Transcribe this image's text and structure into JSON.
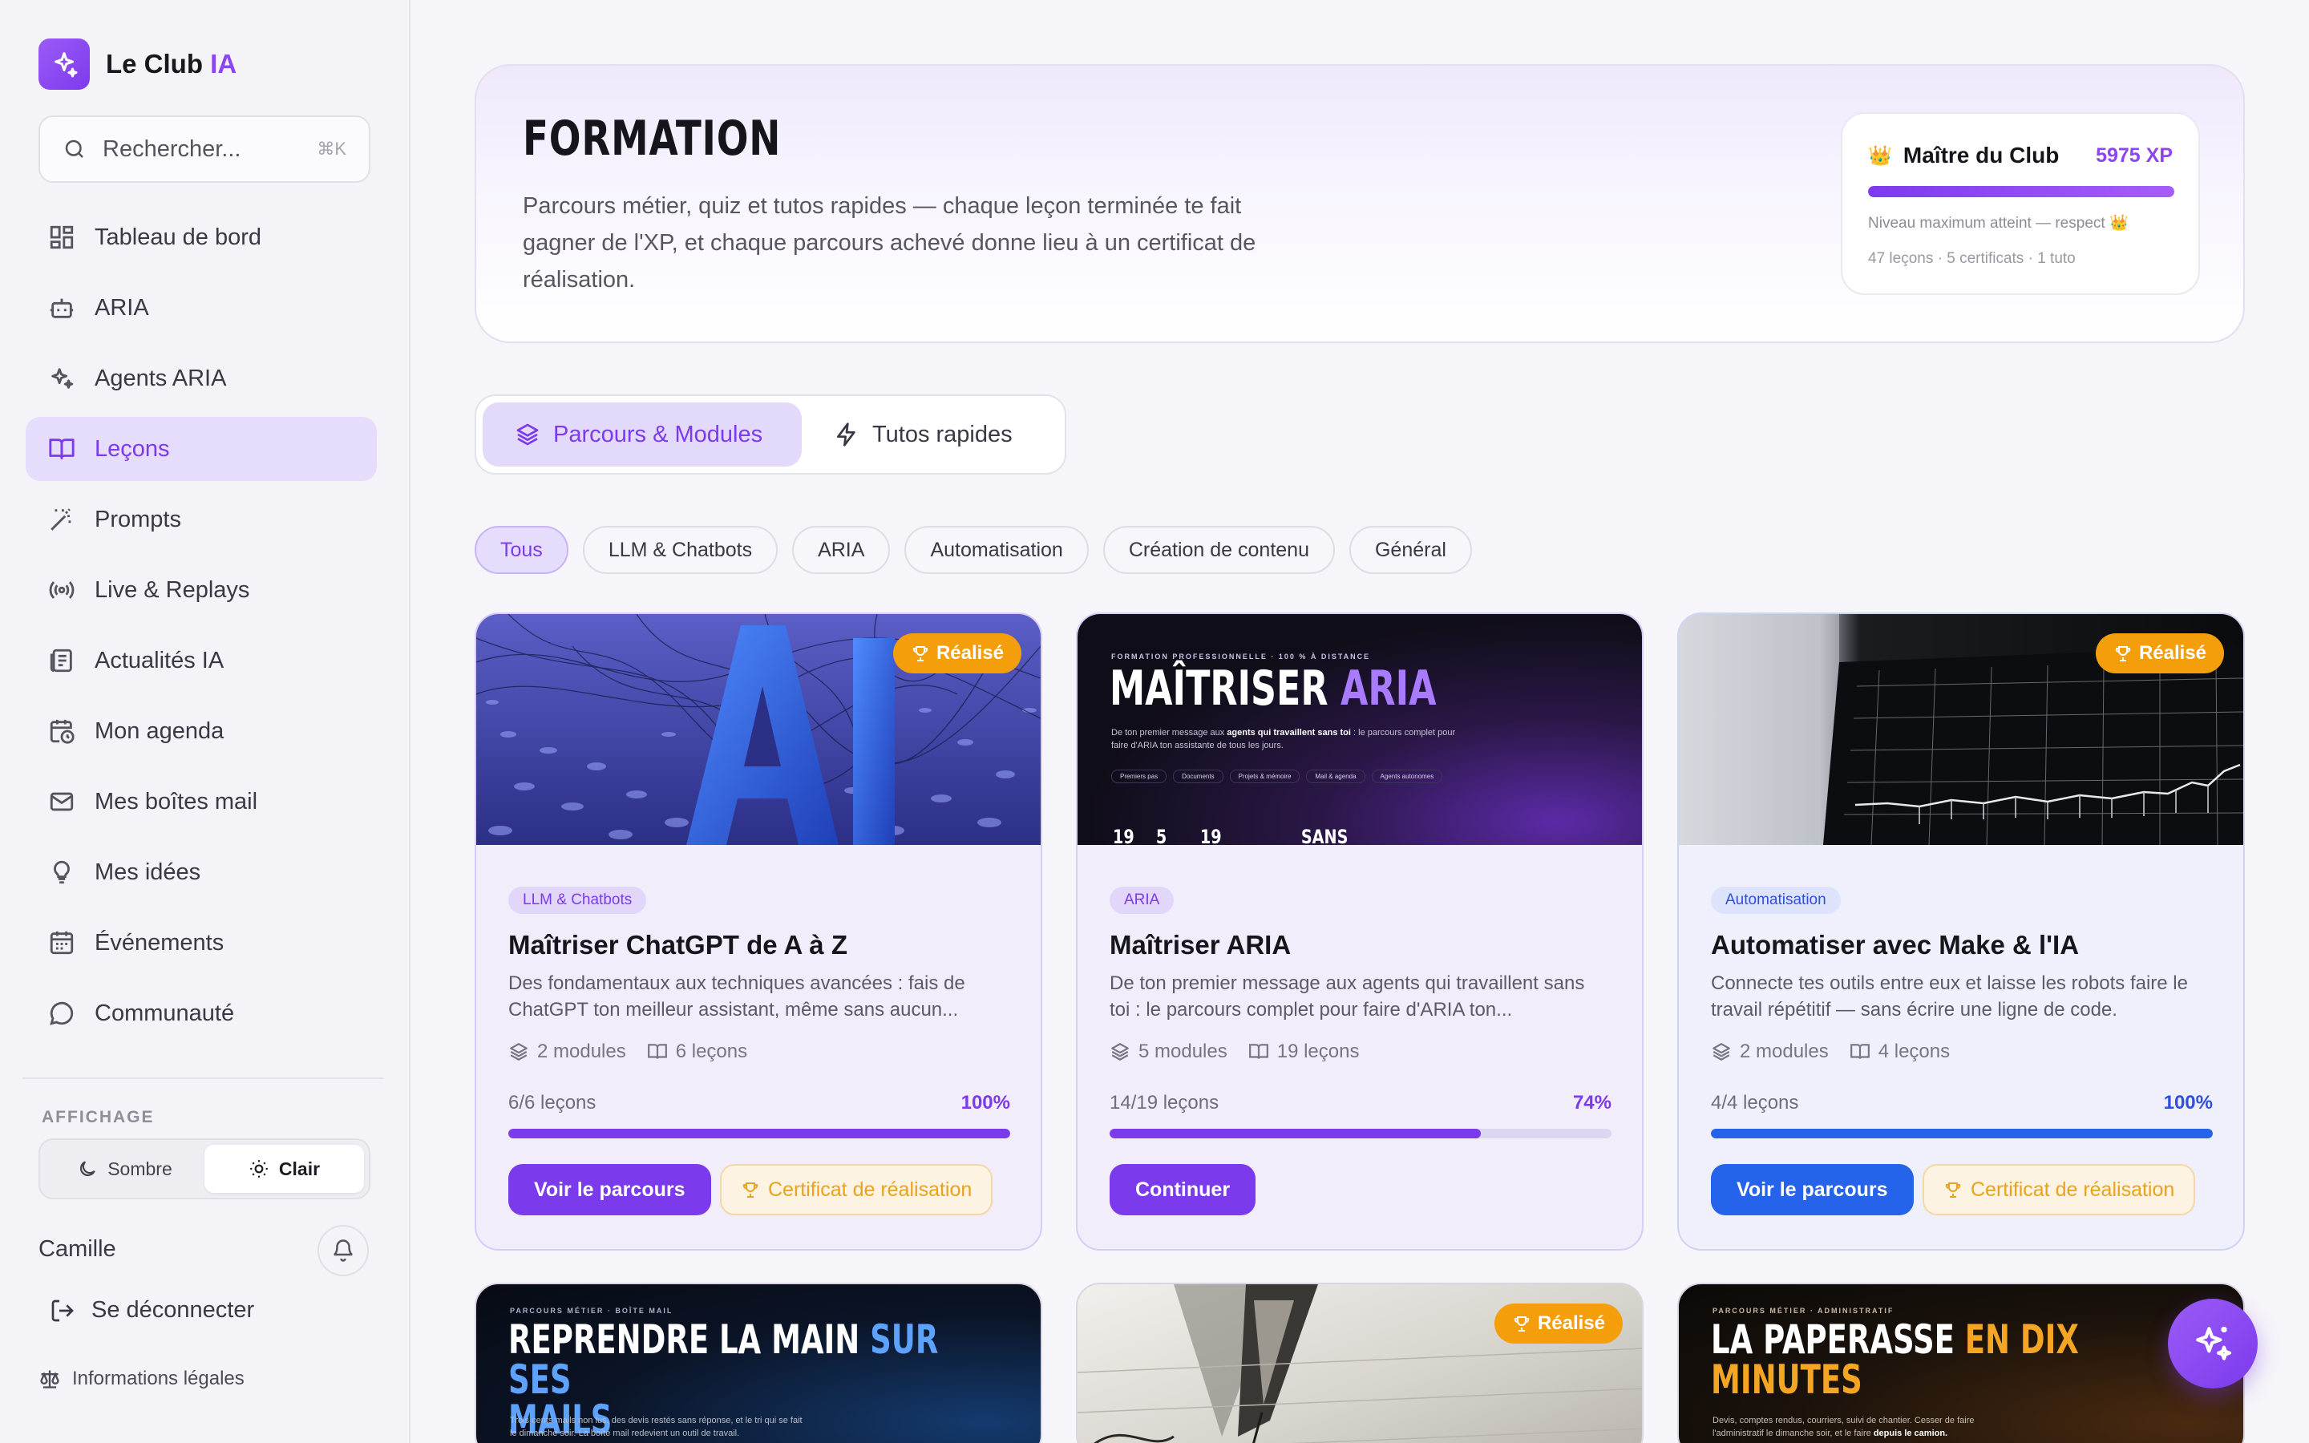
{
  "brand": {
    "name": "Le Club ",
    "accent": "IA"
  },
  "search": {
    "placeholder": "Rechercher...",
    "shortcut": "⌘K"
  },
  "nav": [
    {
      "label": "Tableau de bord",
      "icon": "dashboard-icon"
    },
    {
      "label": "ARIA",
      "icon": "bot-icon"
    },
    {
      "label": "Agents ARIA",
      "icon": "sparkles-icon"
    },
    {
      "label": "Leçons",
      "icon": "book-open-icon",
      "active": true
    },
    {
      "label": "Prompts",
      "icon": "wand-icon"
    },
    {
      "label": "Live & Replays",
      "icon": "broadcast-icon"
    },
    {
      "label": "Actualités IA",
      "icon": "newspaper-icon"
    },
    {
      "label": "Mon agenda",
      "icon": "calendar-clock-icon"
    },
    {
      "label": "Mes boîtes mail",
      "icon": "mail-icon"
    },
    {
      "label": "Mes idées",
      "icon": "lightbulb-icon"
    },
    {
      "label": "Événements",
      "icon": "calendar-icon"
    },
    {
      "label": "Communauté",
      "icon": "chat-bubble-icon"
    }
  ],
  "display": {
    "label": "AFFICHAGE",
    "dark": "Sombre",
    "light": "Clair",
    "selected": "Clair"
  },
  "user": {
    "name": "Camille",
    "logout": "Se déconnecter",
    "legal": "Informations légales"
  },
  "hero": {
    "title": "FORMATION",
    "description": "Parcours métier, quiz et tutos rapides — chaque leçon terminée te fait gagner de l'XP, et chaque parcours achevé donne lieu à un certificat de réalisation."
  },
  "xp": {
    "crown": "👑",
    "title": "Maître du Club",
    "value": "5975 XP",
    "progress": 1.0,
    "note": "Niveau maximum atteint — respect 👑",
    "stats": "47 leçons · 5 certificats · 1 tuto"
  },
  "tabs": [
    {
      "label": "Parcours & Modules",
      "active": true
    },
    {
      "label": "Tutos rapides"
    }
  ],
  "filters": [
    "Tous",
    "LLM & Chatbots",
    "ARIA",
    "Automatisation",
    "Création de contenu",
    "Général"
  ],
  "filter_selected": "Tous",
  "cards": [
    {
      "badge": "Réalisé",
      "category": "LLM & Chatbots",
      "title": "Maîtriser ChatGPT de A à Z",
      "description": "Des fondamentaux aux techniques avancées : fais de ChatGPT ton meilleur assistant, même sans aucun...",
      "modules": "2 modules",
      "lessons": "6 leçons",
      "progress_text": "6/6 leçons",
      "progress_pct": "100%",
      "progress": 1.0,
      "primary": "Voir le parcours",
      "certificate": "Certificat de réalisation",
      "thumb_text": "AI"
    },
    {
      "category": "ARIA",
      "title": "Maîtriser ARIA",
      "description": "De ton premier message aux agents qui travaillent sans toi : le parcours complet pour faire d'ARIA ton...",
      "modules": "5 modules",
      "lessons": "19 leçons",
      "progress_text": "14/19 leçons",
      "progress_pct": "74%",
      "progress": 0.74,
      "primary": "Continuer",
      "thumb": {
        "kicker": "FORMATION PROFESSIONNELLE · 100 % À DISTANCE",
        "headline_a": "MAÎTRISER ",
        "headline_b": "ARIA",
        "sub_a": "De ton premier message aux ",
        "sub_b": "agents qui travaillent sans toi",
        "sub_c": " : le parcours complet pour faire d'ARIA ton assistante de tous les jours.",
        "pills": [
          "Premiers pas",
          "Documents",
          "Projets & mémoire",
          "Mail & agenda",
          "Agents autonomes"
        ],
        "stats": [
          "19",
          "5",
          "19",
          "SANS"
        ]
      }
    },
    {
      "badge": "Réalisé",
      "category": "Automatisation",
      "title": "Automatiser avec Make & l'IA",
      "description": "Connecte tes outils entre eux et laisse les robots faire le travail répétitif — sans écrire une ligne de code.",
      "modules": "2 modules",
      "lessons": "4 leçons",
      "progress_text": "4/4 leçons",
      "progress_pct": "100%",
      "progress": 1.0,
      "primary": "Voir le parcours",
      "certificate": "Certificat de réalisation"
    }
  ],
  "cards_row2": [
    {
      "kicker": "PARCOURS MÉTIER · BOÎTE MAIL",
      "headline_a": "REPRENDRE LA MAIN ",
      "headline_b": "SUR SES",
      "headline_c": "MAILS",
      "sub_a": "Trois cents mails non lus, des devis restés sans réponse, et le tri qui se fait",
      "sub_b": "le dimanche soir. La boîte mail redevient un outil de travail."
    },
    {
      "badge": "Réalisé"
    },
    {
      "kicker": "PARCOURS MÉTIER · ADMINISTRATIF",
      "headline_a": "LA PAPERASSE ",
      "headline_b": "EN DIX",
      "headline_c": "MINUTES",
      "sub_a": "Devis, comptes rendus, courriers, suivi de chantier. Cesser de faire",
      "sub_b": "l'administratif le dimanche soir, et le faire ",
      "sub_c": "depuis le camion."
    }
  ],
  "colors": {
    "accent": "#7c3aed",
    "blue": "#2563eb",
    "amber": "#f59e0b"
  }
}
